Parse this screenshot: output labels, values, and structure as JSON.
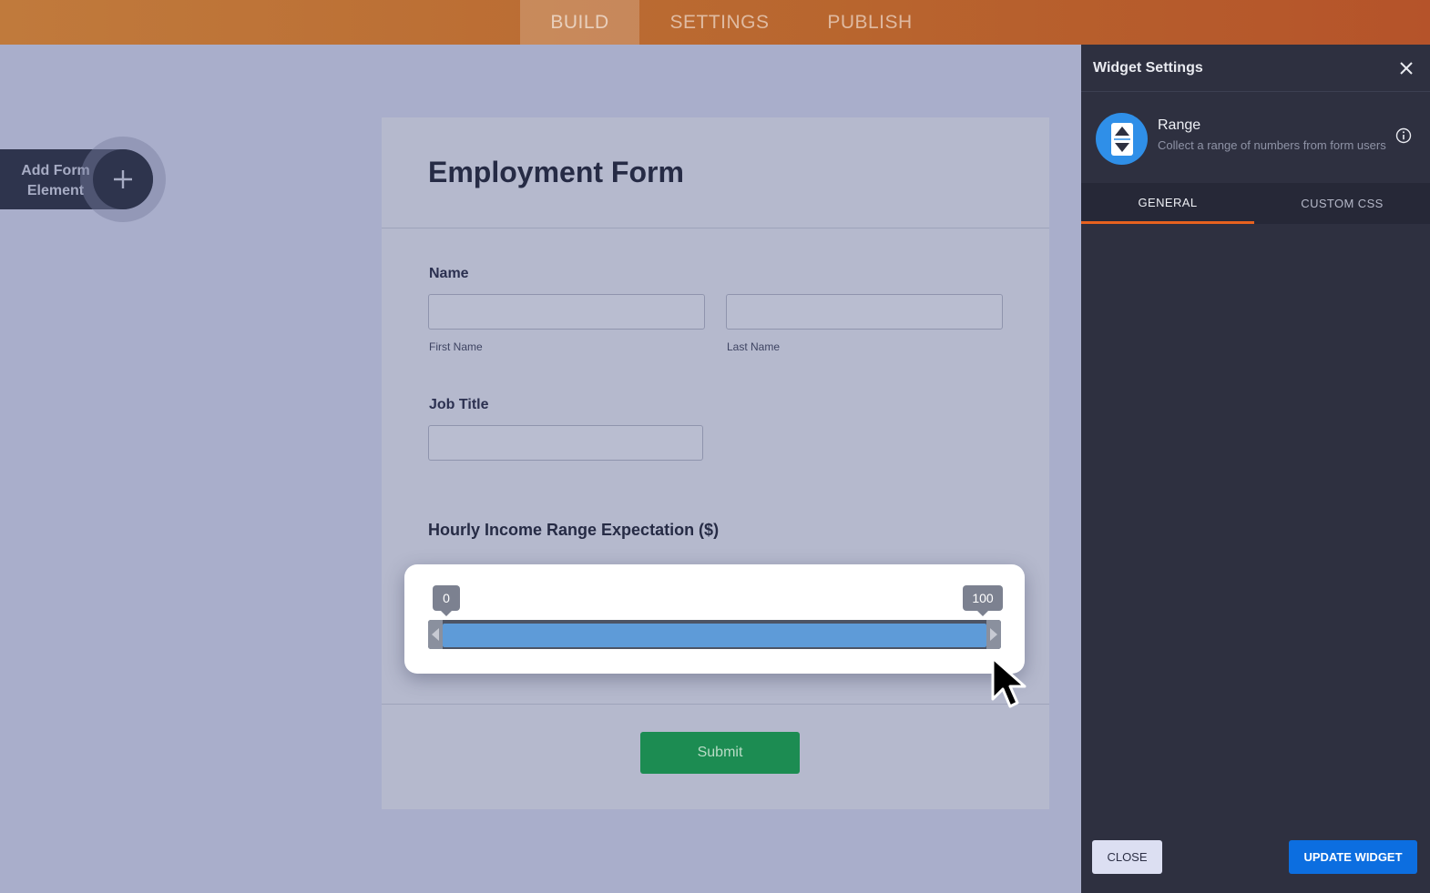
{
  "topnav": {
    "tabs": [
      {
        "label": "BUILD",
        "active": true
      },
      {
        "label": "SETTINGS",
        "active": false
      },
      {
        "label": "PUBLISH",
        "active": false
      }
    ]
  },
  "sidebar": {
    "add_element_label": "Add Form Element",
    "add_icon": "plus-icon"
  },
  "form": {
    "title": "Employment Form",
    "name_label": "Name",
    "first_name_sublabel": "First Name",
    "last_name_sublabel": "Last Name",
    "first_name_value": "",
    "last_name_value": "",
    "job_title_label": "Job Title",
    "job_title_value": "",
    "range_label": "Hourly Income Range Expectation ($)",
    "range": {
      "min_value": "0",
      "max_value": "100"
    },
    "submit_label": "Submit"
  },
  "panel": {
    "title": "Widget Settings",
    "close_icon": "close-icon",
    "widget_name": "Range",
    "widget_description": "Collect a range of numbers from form users",
    "widget_icon": "range-stepper-icon",
    "info_icon": "info-icon",
    "tabs": [
      {
        "label": "GENERAL",
        "active": true
      },
      {
        "label": "CUSTOM CSS",
        "active": false
      }
    ],
    "close_button": "CLOSE",
    "update_button": "UPDATE WIDGET"
  },
  "colors": {
    "accent": "#e8621f",
    "primary_button": "#0c6ee0",
    "submit": "#1c8c52",
    "range_fill": "#5e9bd8"
  }
}
